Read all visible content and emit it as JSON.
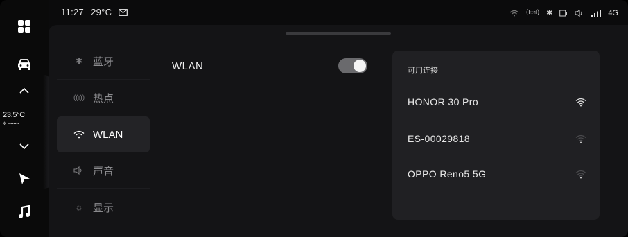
{
  "status_bar": {
    "time": "11:27",
    "temperature": "29°C",
    "network": "4G",
    "icons": [
      "mail-icon",
      "wifi-icon",
      "hotspot-icon",
      "bluetooth-icon",
      "screen-icon",
      "volume-icon",
      "signal-icon"
    ]
  },
  "left_rail": {
    "climate_temp": "23.5°C",
    "icons": [
      "apps-grid-icon",
      "car-icon",
      "chevron-up-icon",
      "chevron-down-icon",
      "navigation-icon",
      "music-icon"
    ]
  },
  "menu": {
    "items": [
      {
        "icon": "bluetooth-icon",
        "label": "蓝牙"
      },
      {
        "icon": "hotspot-icon",
        "label": "热点"
      },
      {
        "icon": "wifi-icon",
        "label": "WLAN"
      },
      {
        "icon": "sound-icon",
        "label": "声音"
      },
      {
        "icon": "brightness-icon",
        "label": "显示"
      }
    ],
    "active_index": 2
  },
  "wlan": {
    "label": "WLAN",
    "enabled": true
  },
  "available": {
    "title": "可用连接",
    "networks": [
      {
        "name": "HONOR 30 Pro",
        "signal": "strong"
      },
      {
        "name": "ES-00029818",
        "signal": "weak"
      },
      {
        "name": "OPPO Reno5 5G",
        "signal": "weak"
      }
    ]
  },
  "colors": {
    "background": "#0b0b0c",
    "panel": "#141416",
    "card": "#202023",
    "toggle_on": "#6a6a6d"
  }
}
